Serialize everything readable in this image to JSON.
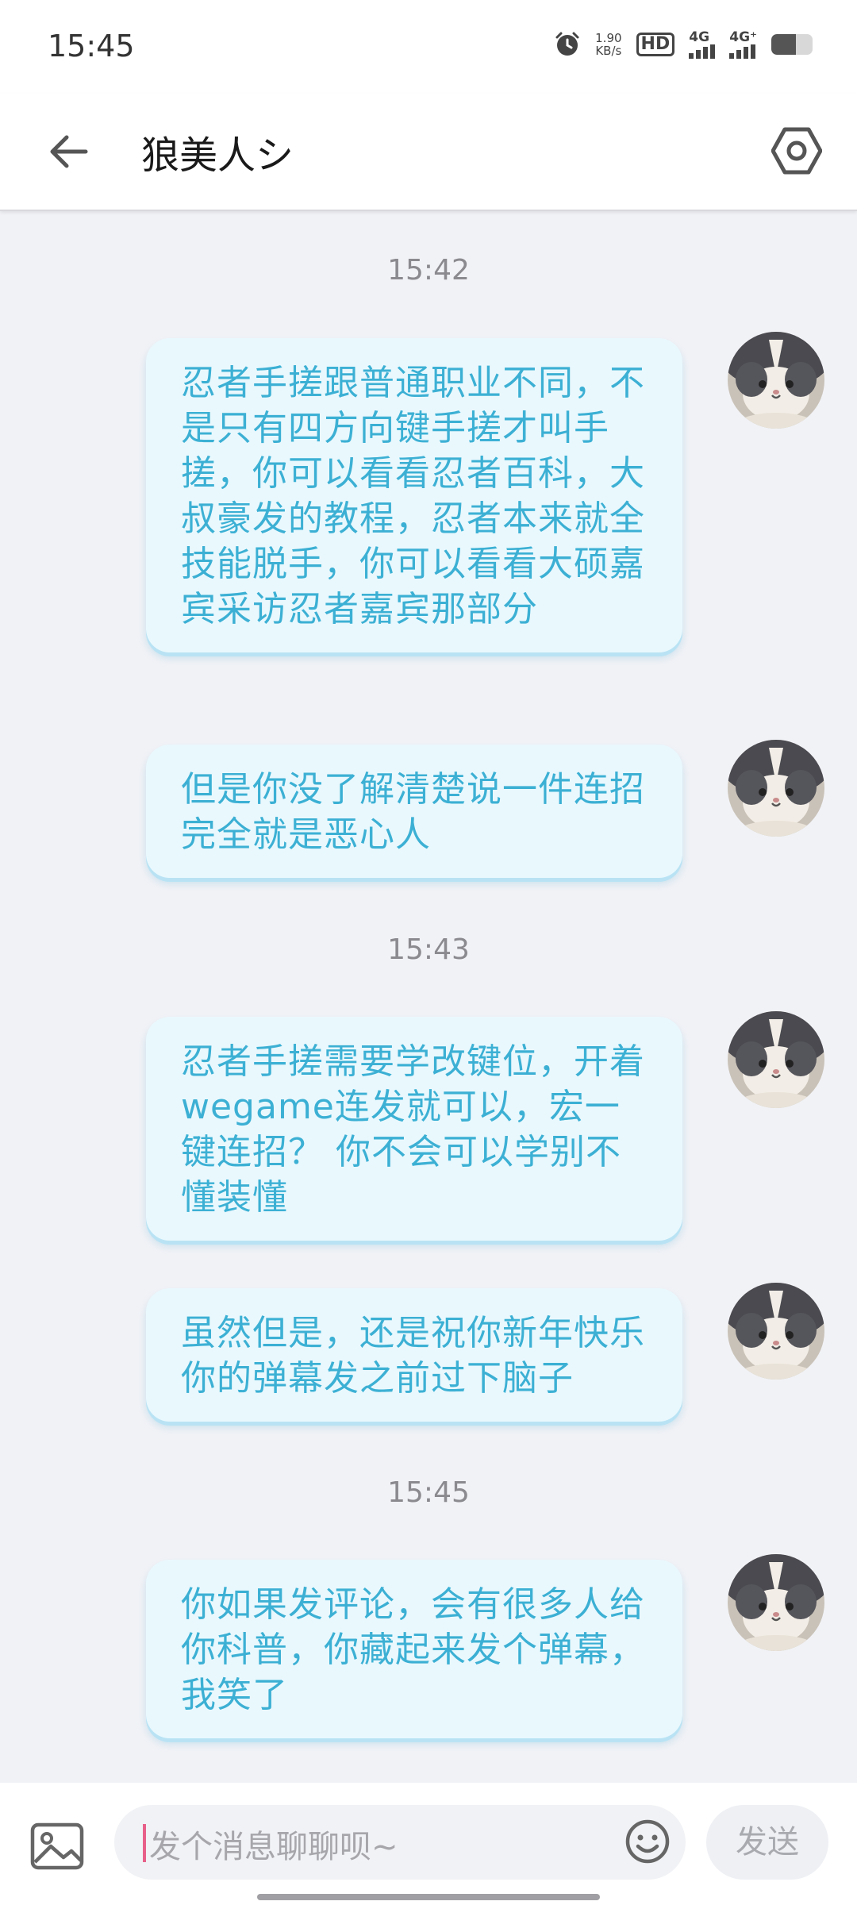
{
  "status_bar": {
    "time": "15:45",
    "net_speed_value": "1.90",
    "net_speed_unit": "KB/s",
    "hd_label": "HD",
    "sim1_label": "4G",
    "sim2_label": "4G⁺",
    "battery_level": 0.6
  },
  "header": {
    "title": "狼美人シ",
    "back_icon": "arrow-left-icon",
    "settings_icon": "hexagon-gear-icon"
  },
  "messages": [
    {
      "timestamp": "15:42"
    },
    {
      "text": "忍者手搓跟普通职业不同，不是只有四方向键手搓才叫手搓，你可以看看忍者百科，大叔豪发的教程，忍者本来就全技能脱手，你可以看看大硕嘉宾采访忍者嘉宾那部分"
    },
    {
      "text": "但是你没了解清楚说一件连招 完全就是恶心人"
    },
    {
      "timestamp": "15:43"
    },
    {
      "text": "忍者手搓需要学改键位，开着wegame连发就可以，宏一键连招？ 你不会可以学别不懂装懂"
    },
    {
      "text": "虽然但是，还是祝你新年快乐 你的弹幕发之前过下脑子"
    },
    {
      "timestamp": "15:45"
    },
    {
      "text": "你如果发评论，会有很多人给你科普，你藏起来发个弹幕，我笑了"
    }
  ],
  "input_bar": {
    "placeholder": "发个消息聊聊呗~",
    "send_label": "发送",
    "image_icon": "image-icon",
    "emoji_icon": "emoji-icon"
  },
  "colors": {
    "bubble_bg": "#e9f8fd",
    "bubble_text": "#3cb0d4",
    "page_bg": "#f1f2f6",
    "caret": "#e8608a"
  }
}
